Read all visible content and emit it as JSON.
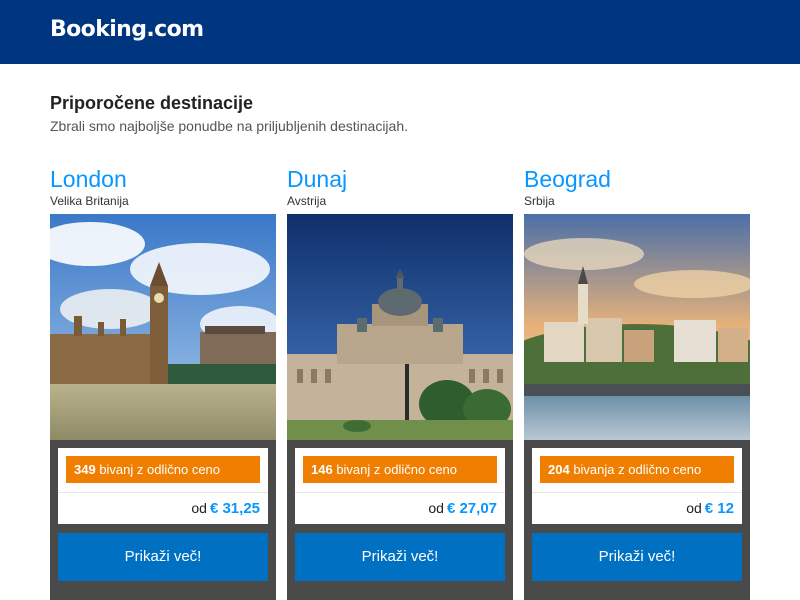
{
  "header": {
    "logo_text": "Booking.com",
    "bg_color": "#003580"
  },
  "section": {
    "title": "Priporočene destinacije",
    "subtitle": "Zbrali smo najboljše ponudbe na priljubljenih destinacijah."
  },
  "colors": {
    "accent_blue": "#0896ff",
    "badge_orange": "#f07e00",
    "button_blue": "#0071c2"
  },
  "destinations": [
    {
      "city": "London",
      "country": "Velika Britanija",
      "stays_count": "349",
      "stays_text": " bivanj z odlično ceno",
      "price_prefix": "od",
      "price": "€ 31,25",
      "button_label": "Prikaži več!"
    },
    {
      "city": "Dunaj",
      "country": "Avstrija",
      "stays_count": "146",
      "stays_text": " bivanj z odlično ceno",
      "price_prefix": "od",
      "price": "€ 27,07",
      "button_label": "Prikaži več!"
    },
    {
      "city": "Beograd",
      "country": "Srbija",
      "stays_count": "204",
      "stays_text": " bivanja z odlično ceno",
      "price_prefix": "od",
      "price": "€ 12",
      "button_label": "Prikaži več!"
    }
  ]
}
